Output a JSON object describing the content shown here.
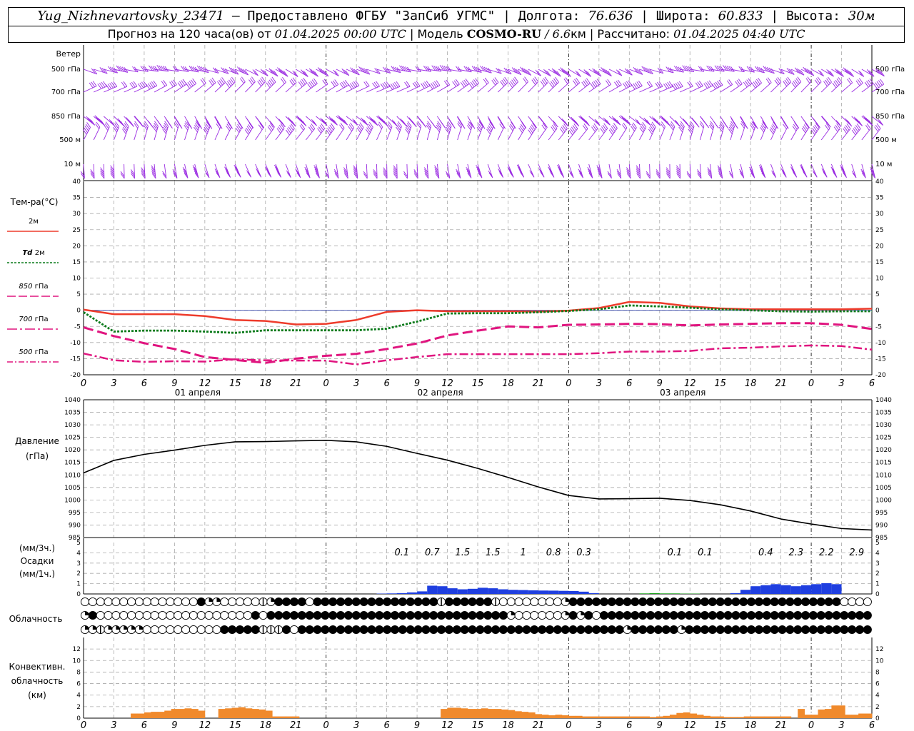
{
  "header": {
    "station": "Yug_Nizhnevartovsky_23471",
    "provider": " — Предоставлено ФГБУ \"ЗапСиб УГМС\" | ",
    "lon_label": "Долгота: ",
    "lon": "76.636",
    "lat_label": " | Широта: ",
    "lat": "60.833",
    "alt_label": " | Высота: ",
    "alt": "30м",
    "forecast_label": "Прогноз на 120 часа(ов) от ",
    "forecast_start": "01.04.2025 00:00 UTC",
    "model_label": "  | Модель ",
    "model": "COSMO-RU",
    "resolution": " / 6.6",
    "resolution_unit": "км",
    "calc_label": " | Рассчитано: ",
    "calc_time": "01.04.2025 04:40 UTC"
  },
  "colors": {
    "wind": "#9a2be2",
    "t2m": "#ee3b2b",
    "td2m": "#0a7a1a",
    "t850": "#e0157f",
    "t700": "#e0157f",
    "t500": "#e0157f",
    "pressure": "#000000",
    "precip": "#1f3fe0",
    "precip_small": "#18a018",
    "conv": "#f08a2c",
    "grid": "#aaaaaa"
  },
  "time_axis": {
    "hours": [
      "0",
      "3",
      "6",
      "9",
      "12",
      "15",
      "18",
      "21",
      "0",
      "3",
      "6",
      "9",
      "12",
      "15",
      "18",
      "21",
      "0",
      "3",
      "6",
      "9",
      "12",
      "15",
      "18",
      "21",
      "0",
      "3",
      "6"
    ],
    "day_labels": [
      "01 апреля",
      "02 апреля",
      "03 апреля"
    ]
  },
  "wind_panel": {
    "label": "Ветер",
    "levels": [
      "500 гПа",
      "700 гПа",
      "850 гПа",
      "500 м",
      "10 м"
    ],
    "levels_right": [
      "500 гПа",
      "700 гПа",
      "850 гПа",
      "500 м",
      "10 м"
    ]
  },
  "temp_panel": {
    "label": "Тем-ра(°С)",
    "legend": [
      {
        "text": "2м",
        "prefix": ""
      },
      {
        "text": "2м",
        "prefix": "Td"
      },
      {
        "text": "гПа",
        "prefix": "850"
      },
      {
        "text": "гПа",
        "prefix": "700"
      },
      {
        "text": "гПа",
        "prefix": "500"
      }
    ]
  },
  "pressure_panel": {
    "label1": "Давление",
    "label2": "(гПа)"
  },
  "precip_panel": {
    "label1": "(мм/3ч.)",
    "label2": "Осадки",
    "label3": "(мм/1ч.)"
  },
  "cloud_panel": {
    "label": "Облачность"
  },
  "conv_panel": {
    "label1": "Конвективн.",
    "label2": "облачность",
    "label3": "(км)"
  },
  "chart_data": [
    {
      "type": "line",
      "title": "Тем-ра(°С)",
      "x": [
        0,
        3,
        6,
        9,
        12,
        15,
        18,
        21,
        24,
        27,
        30,
        33,
        36,
        39,
        42,
        45,
        48,
        51,
        54,
        57,
        60,
        63,
        66,
        69,
        72,
        75,
        78
      ],
      "ylim": [
        -20,
        40
      ],
      "yticks": [
        -20,
        -15,
        -10,
        -5,
        0,
        5,
        10,
        15,
        20,
        25,
        30,
        35,
        40
      ],
      "series": [
        {
          "name": "2м",
          "values": [
            0.2,
            -1.2,
            -1.2,
            -1.2,
            -1.8,
            -3.0,
            -3.3,
            -4.4,
            -4.2,
            -3.0,
            -0.5,
            0.0,
            -0.3,
            -0.3,
            -0.3,
            -0.4,
            -0.1,
            0.7,
            2.6,
            2.3,
            1.2,
            0.6,
            0.3,
            0.3,
            0.3,
            0.3,
            0.5
          ]
        },
        {
          "name": "Td 2м",
          "values": [
            -0.6,
            -6.6,
            -6.3,
            -6.3,
            -6.6,
            -7.0,
            -6.2,
            -6.2,
            -6.2,
            -6.2,
            -5.7,
            -3.5,
            -1.0,
            -0.9,
            -0.9,
            -0.6,
            -0.2,
            0.3,
            1.5,
            1.2,
            0.8,
            0.3,
            0.0,
            -0.3,
            -0.4,
            -0.3,
            -0.3
          ]
        },
        {
          "name": "850 гПа",
          "values": [
            -5.3,
            -8.0,
            -10.2,
            -12.0,
            -14.5,
            -15.4,
            -16.3,
            -15.0,
            -14.1,
            -13.5,
            -12.0,
            -10.3,
            -7.8,
            -6.3,
            -5.0,
            -5.3,
            -4.5,
            -4.4,
            -4.2,
            -4.3,
            -4.7,
            -4.4,
            -4.2,
            -4.0,
            -4.0,
            -4.5,
            -5.8
          ]
        },
        {
          "name": "700 гПа",
          "values": [
            -13.4,
            -15.5,
            -16.0,
            -15.8,
            -15.9,
            -15.2,
            -15.5,
            -15.6,
            -15.6,
            -16.8,
            -15.5,
            -14.5,
            -13.6,
            -13.6,
            -13.6,
            -13.6,
            -13.6,
            -13.3,
            -12.8,
            -12.8,
            -12.6,
            -11.8,
            -11.6,
            -11.2,
            -10.9,
            -11.1,
            -12.2
          ]
        }
      ]
    },
    {
      "type": "line",
      "title": "Давление",
      "x": [
        0,
        3,
        6,
        9,
        12,
        15,
        18,
        21,
        24,
        27,
        30,
        33,
        36,
        39,
        42,
        45,
        48,
        51,
        54,
        57,
        60,
        63,
        66,
        69,
        72,
        75,
        78
      ],
      "ylim": [
        985,
        1040
      ],
      "yticks": [
        985,
        990,
        995,
        1000,
        1005,
        1010,
        1015,
        1020,
        1025,
        1030,
        1035,
        1040
      ],
      "series": [
        {
          "name": "Давление",
          "values": [
            1010.8,
            1015.8,
            1018.2,
            1019.9,
            1021.8,
            1023.2,
            1023.3,
            1023.6,
            1023.8,
            1023.2,
            1021.4,
            1018.6,
            1015.9,
            1012.6,
            1009.0,
            1005.2,
            1001.8,
            1000.4,
            1000.5,
            1000.7,
            999.8,
            998.1,
            995.6,
            992.4,
            990.4,
            988.6,
            988.0
          ]
        }
      ]
    },
    {
      "type": "bar",
      "title": "Осадки",
      "ylim": [
        0,
        5
      ],
      "yticks": [
        0,
        1,
        2,
        3,
        4,
        5
      ],
      "labels": [
        "0.1",
        "0.7",
        "1.5",
        "1.5",
        "1",
        "0.8",
        "0.3",
        "0.1",
        "0.1",
        "0.4",
        "2.3",
        "2.2",
        "2.9"
      ],
      "label_hours": [
        31.5,
        34.5,
        37.5,
        40.5,
        43.5,
        46.5,
        49.5,
        58.5,
        61.5,
        67.5,
        70.5,
        73.5,
        76.5
      ],
      "hourly": [
        0,
        0,
        0,
        0,
        0,
        0,
        0,
        0,
        0,
        0,
        0,
        0,
        0,
        0,
        0,
        0,
        0,
        0,
        0,
        0,
        0,
        0,
        0,
        0,
        0,
        0,
        0,
        0,
        0,
        0.03,
        0.05,
        0.08,
        0.15,
        0.25,
        0.8,
        0.75,
        0.55,
        0.45,
        0.5,
        0.6,
        0.55,
        0.45,
        0.4,
        0.38,
        0.35,
        0.33,
        0.32,
        0.3,
        0.28,
        0.22,
        0.08,
        0,
        0,
        0,
        0,
        0.05,
        0.07,
        0.05,
        0.05,
        0.03,
        0.03,
        0,
        0,
        0,
        0.08,
        0.4,
        0.75,
        0.85,
        0.95,
        0.85,
        0.75,
        0.85,
        0.95,
        1.05,
        0.95
      ]
    },
    {
      "type": "bar",
      "title": "Конвективн. облачность (км)",
      "ylim": [
        0,
        14
      ],
      "yticks": [
        0,
        2,
        4,
        6,
        8,
        10,
        12
      ],
      "hourly": [
        0,
        0,
        0,
        0,
        0,
        0,
        0,
        0.8,
        0.8,
        1.0,
        1.1,
        1.1,
        1.3,
        1.6,
        1.6,
        1.7,
        1.6,
        1.3,
        0,
        0,
        1.6,
        1.7,
        1.8,
        1.9,
        1.7,
        1.6,
        1.5,
        1.3,
        0.3,
        0.3,
        0.3,
        0.3,
        0,
        0,
        0,
        0,
        0,
        0,
        0,
        0,
        0,
        0,
        0,
        0,
        0,
        0,
        0,
        0,
        0,
        0,
        0,
        0,
        0,
        1.6,
        1.8,
        1.8,
        1.7,
        1.6,
        1.6,
        1.7,
        1.6,
        1.6,
        1.5,
        1.4,
        1.2,
        1.1,
        1.0,
        0.7,
        0.6,
        0.5,
        0.6,
        0.5,
        0.4,
        0.4,
        0.3,
        0.3,
        0.3,
        0.3,
        0.3,
        0.3,
        0.3,
        0.3,
        0.3,
        0.3,
        0.2,
        0.3,
        0.4,
        0.6,
        0.9,
        1.0,
        0.8,
        0.6,
        0.4,
        0.3,
        0.3,
        0.2,
        0.2,
        0.2,
        0.3,
        0.3,
        0.3,
        0.3,
        0.3,
        0.3,
        0.3,
        0,
        1.6,
        0.6,
        0.6,
        1.5,
        1.6,
        2.2,
        2.2,
        0.6,
        0.6,
        0.8,
        0.8
      ]
    }
  ],
  "cloud_symbols": {
    "row1": "000000000000000422000001244440444444444444444414444441000000002444444444444444444444444444444444440000",
    "row2": "240000000000000000000040444444444444444444444444444444420000002424044444444444444444444444444444444444",
    "row3": "221222220000000000444441114044444444444444444444444444444444444444444424444442444444444444444444444444"
  }
}
